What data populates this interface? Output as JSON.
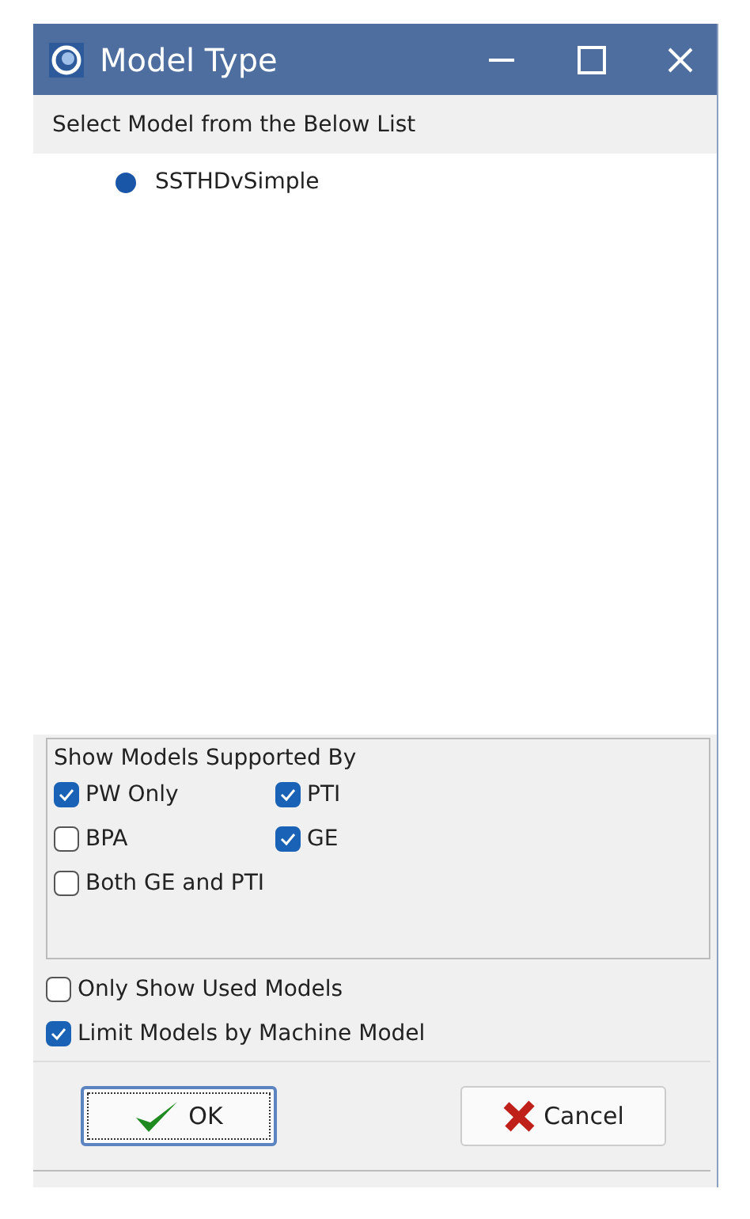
{
  "window": {
    "title": "Model Type"
  },
  "list": {
    "header": "Select Model from the Below List",
    "items": [
      {
        "label": "SSTHDvSimple",
        "selected": true
      }
    ]
  },
  "group": {
    "title": "Show Models Supported By",
    "options": [
      {
        "label": "PW Only",
        "checked": true
      },
      {
        "label": "PTI",
        "checked": true
      },
      {
        "label": "BPA",
        "checked": false
      },
      {
        "label": "GE",
        "checked": true
      },
      {
        "label": "Both GE and PTI",
        "checked": false
      }
    ]
  },
  "options": [
    {
      "label": "Only Show Used Models",
      "checked": false
    },
    {
      "label": "Limit Models by Machine Model",
      "checked": true
    }
  ],
  "buttons": [
    {
      "label": "OK",
      "kind": "ok"
    },
    {
      "label": "Cancel",
      "kind": "cancel"
    }
  ]
}
